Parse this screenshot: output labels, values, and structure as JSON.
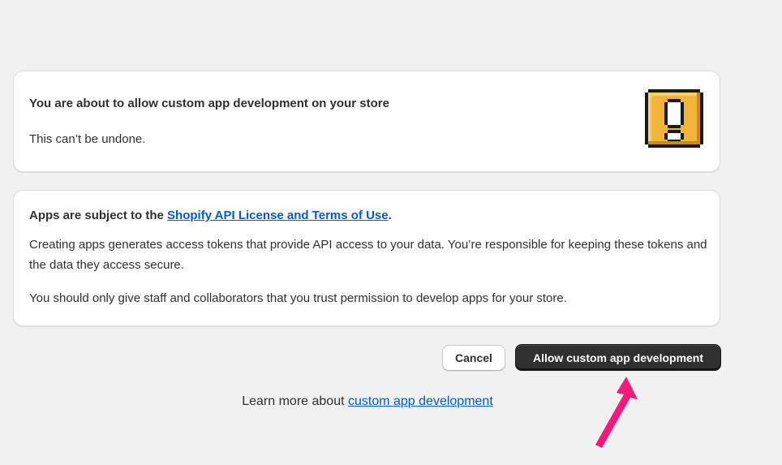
{
  "warning_card": {
    "title": "You are about to allow custom app development on your store",
    "body": "This can’t be undone.",
    "icon": "exclamation-icon",
    "icon_colors": {
      "fill": "#f0b53a",
      "outline": "#1a1a1a"
    }
  },
  "terms_card": {
    "heading_prefix": "Apps are subject to the ",
    "heading_link": "Shopify API License and Terms of Use",
    "heading_suffix": ".",
    "paragraph_1": "Creating apps generates access tokens that provide API access to your data. You’re responsible for keeping these tokens and the data they access secure.",
    "paragraph_2": "You should only give staff and collaborators that you trust permission to develop apps for your store."
  },
  "actions": {
    "cancel_label": "Cancel",
    "allow_label": "Allow custom app development"
  },
  "footer": {
    "learn_more_prefix": "Learn more about ",
    "learn_more_link": "custom app development"
  },
  "colors": {
    "page_background": "#f1f1f1",
    "link": "#005bd3",
    "primary_button": "#303030",
    "annotation_arrow": "#f5197a"
  }
}
